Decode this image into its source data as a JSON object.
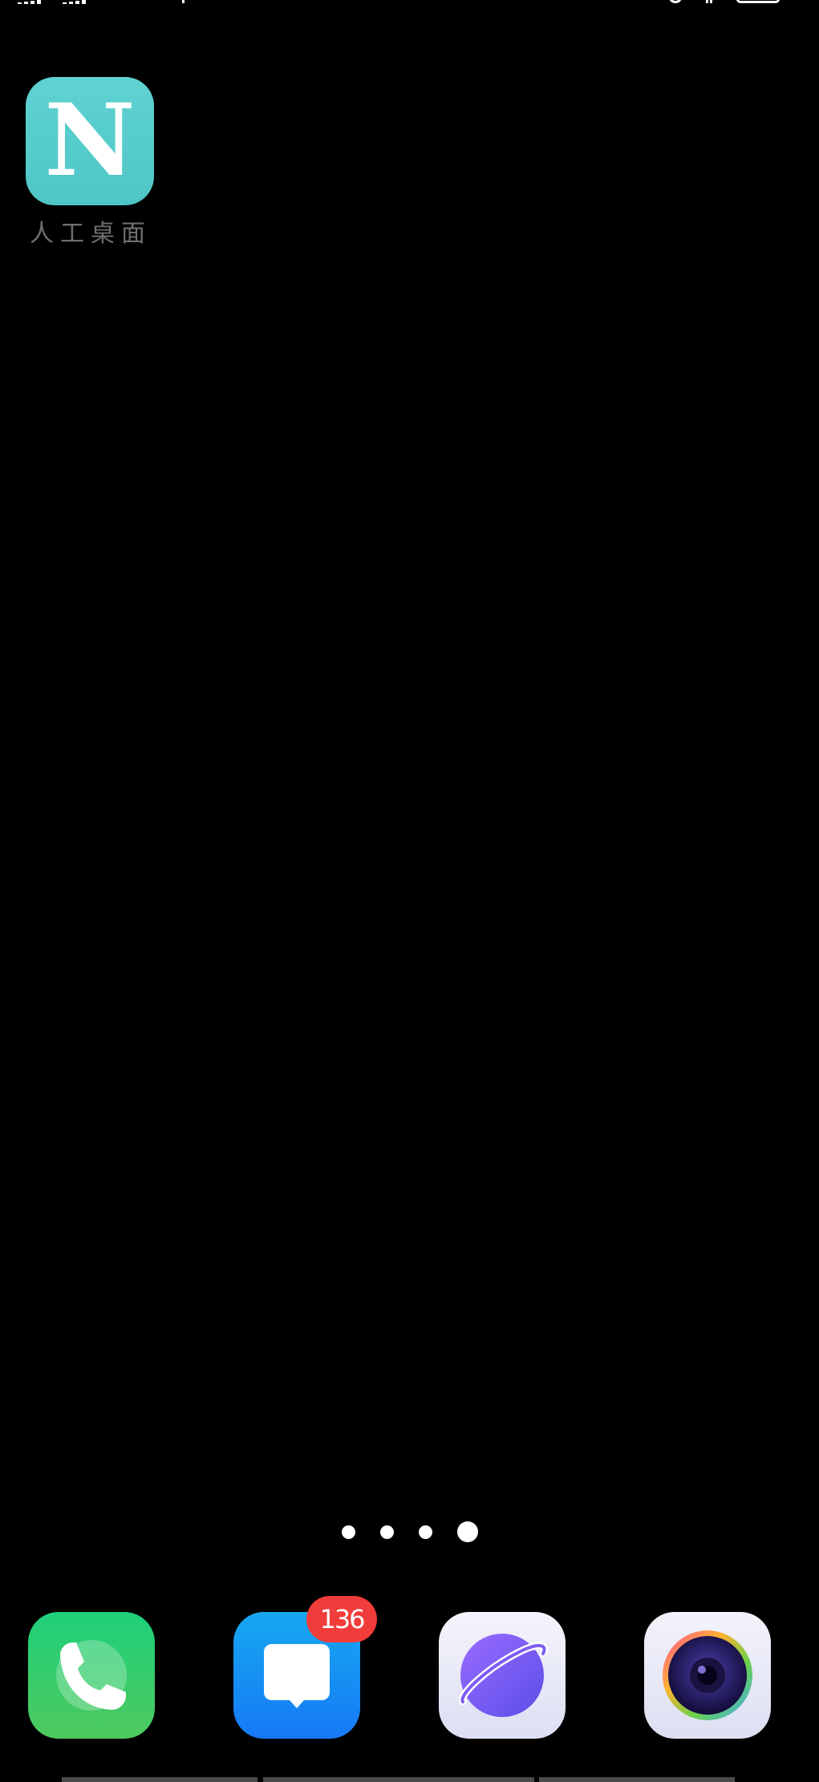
{
  "status_bar": {
    "icons": [
      "signal-icon",
      "signal-icon",
      "alarm-icon",
      "bluetooth-icon",
      "battery-icon"
    ]
  },
  "home_screen": {
    "apps": [
      {
        "label": "人工桌面",
        "icon_letter": "N",
        "icon": "app-n-icon"
      }
    ]
  },
  "page_indicator": {
    "count": 4,
    "active_index": 3
  },
  "dock": {
    "apps": [
      {
        "icon": "phone-icon"
      },
      {
        "icon": "messages-icon",
        "badge": "136"
      },
      {
        "icon": "browser-icon"
      },
      {
        "icon": "camera-icon"
      }
    ]
  },
  "colors": {
    "background": "#000000",
    "home_app_teal": "#5fd3d2",
    "phone_green": "#1ed07a",
    "messages_blue": "#1679f5",
    "browser_purple": "#7b5cf5",
    "badge_red": "#f03c3a"
  }
}
